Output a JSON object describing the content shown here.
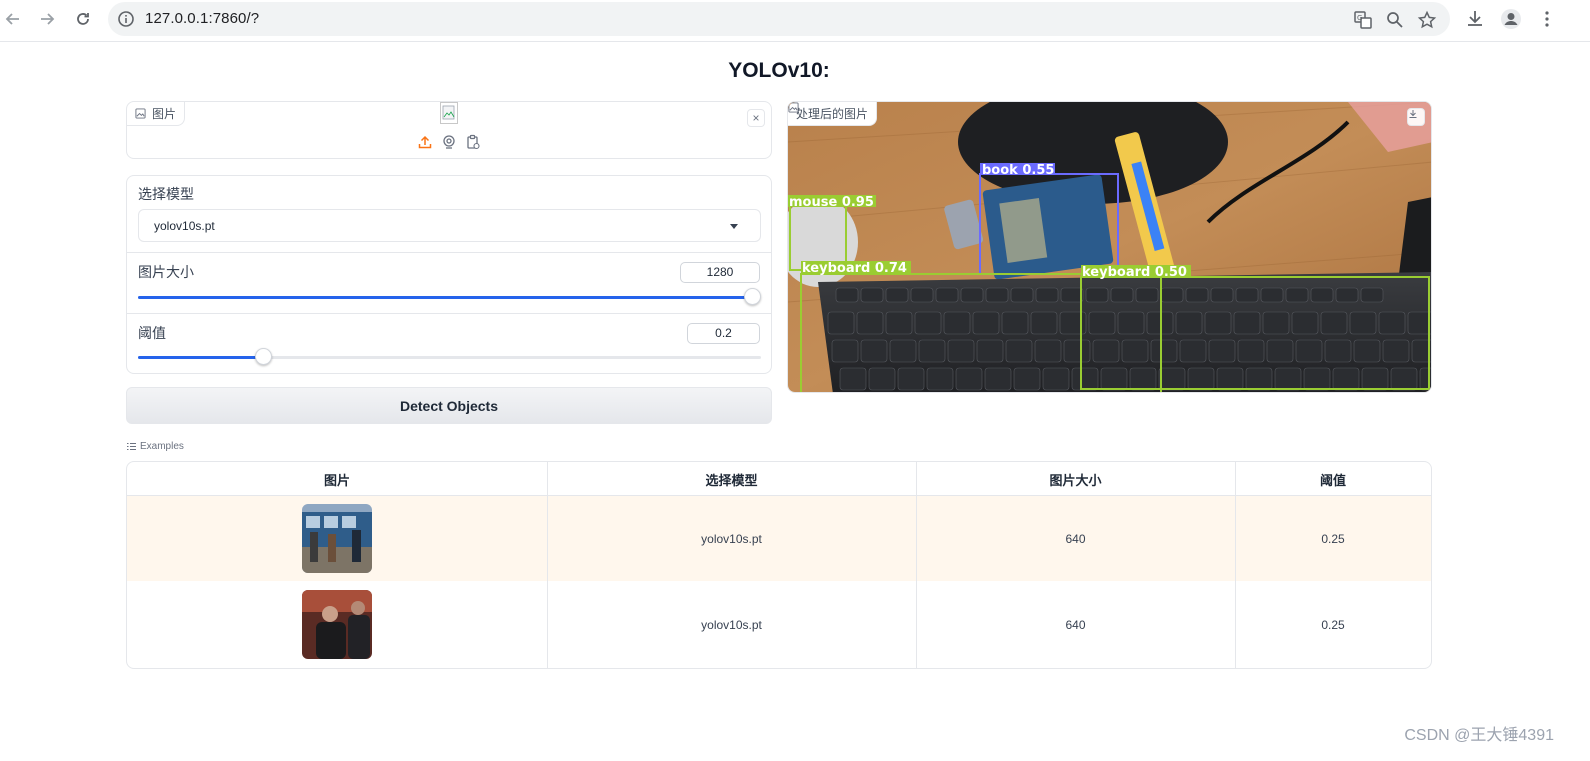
{
  "browser": {
    "url": "127.0.0.1:7860/?"
  },
  "page": {
    "title": "YOLOv10:"
  },
  "input_image": {
    "label": "图片",
    "clear_symbol": "×"
  },
  "model_select": {
    "label": "选择模型",
    "value": "yolov10s.pt"
  },
  "image_size": {
    "label": "图片大小",
    "value": "1280",
    "fraction": 1.0
  },
  "threshold": {
    "label": "阈值",
    "value": "0.2",
    "fraction": 0.2
  },
  "detect_button": {
    "label": "Detect Objects"
  },
  "output_image": {
    "label": "处理后的图片",
    "detections": [
      {
        "label": "book 0.55",
        "color": "#6b6bff"
      },
      {
        "label": "mouse 0.95",
        "color": "#9acd32"
      },
      {
        "label": "keyboard 0.74",
        "color": "#9acd32"
      },
      {
        "label": "keyboard 0.50",
        "color": "#9acd32"
      }
    ]
  },
  "examples": {
    "label": "Examples",
    "headers": [
      "图片",
      "选择模型",
      "图片大小",
      "阈值"
    ],
    "rows": [
      {
        "model": "yolov10s.pt",
        "size": "640",
        "threshold": "0.25"
      },
      {
        "model": "yolov10s.pt",
        "size": "640",
        "threshold": "0.25"
      }
    ]
  },
  "watermark": "CSDN @王大锤4391",
  "colors": {
    "accent": "#2563eb",
    "upload_icon": "#f97316",
    "row_highlight": "#fff7ed"
  }
}
